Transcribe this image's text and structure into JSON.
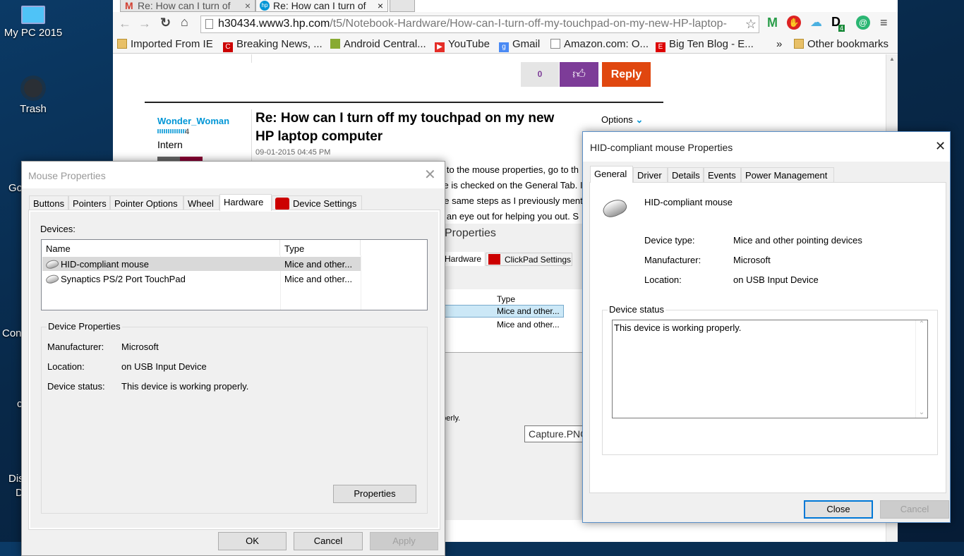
{
  "desktop": {
    "icons": [
      "My PC 2015",
      "Trash",
      "Go",
      "Con",
      "c",
      "Dis",
      "D"
    ]
  },
  "browser": {
    "tabs": [
      {
        "title": "Re: How can I turn of",
        "icon": "gmail-icon"
      },
      {
        "title": "Re: How can I turn of",
        "icon": "hp-icon"
      }
    ],
    "url_host": "h30434.www3.hp.com",
    "url_path": "/t5/Notebook-Hardware/How-can-I-turn-off-my-touchpad-on-my-new-HP-laptop-",
    "extensions": [
      "M",
      "✋",
      "☁",
      "D",
      "@"
    ],
    "ext_badge": "4",
    "bookmarks": [
      "Imported From IE",
      "Breaking News, ...",
      "Android Central...",
      "YouTube",
      "Gmail",
      "Amazon.com: O...",
      "Big Ten Blog - E..."
    ],
    "bookmarks_overflow": "»",
    "other_bookmarks": "Other bookmarks"
  },
  "post": {
    "kudos_count": "0",
    "reply_label": "Reply",
    "author": "Wonder_Woman",
    "rank_level": "4",
    "rank": "Intern",
    "title": "Re: How can I turn off my touchpad on my new HP laptop computer",
    "date": "09-01-2015 04:45 PM",
    "options_label": "Options",
    "body_lines": [
      "o to the mouse properties, go to th",
      "se is checked on the General Tab.  I",
      "he same steps as I previously ment",
      "p an eye out for helping you out.  S"
    ],
    "embedded": {
      "title": "Properties",
      "tab_hardware": "Hardware",
      "tab_clickpad": "ClickPad Settings",
      "col_type": "Type",
      "row1": "Mice and other...",
      "row2": "Mice and other...",
      "status_tail": "operly."
    },
    "tooltip": "Capture.PNG"
  },
  "mouse_props": {
    "title": "Mouse Properties",
    "tabs": [
      "Buttons",
      "Pointers",
      "Pointer Options",
      "Wheel",
      "Hardware",
      "Device Settings"
    ],
    "devices_label": "Devices:",
    "columns": [
      "Name",
      "Type"
    ],
    "devices": [
      {
        "name": "HID-compliant mouse",
        "type": "Mice and other..."
      },
      {
        "name": "Synaptics PS/2 Port TouchPad",
        "type": "Mice and other..."
      }
    ],
    "group_label": "Device Properties",
    "props": [
      {
        "label": "Manufacturer:",
        "value": "Microsoft"
      },
      {
        "label": "Location:",
        "value": "on USB Input Device"
      },
      {
        "label": "Device status:",
        "value": "This device is working properly."
      }
    ],
    "properties_button": "Properties",
    "ok": "OK",
    "cancel": "Cancel",
    "apply": "Apply"
  },
  "hid_props": {
    "title": "HID-compliant mouse Properties",
    "tabs": [
      "General",
      "Driver",
      "Details",
      "Events",
      "Power Management"
    ],
    "device_name": "HID-compliant mouse",
    "props": [
      {
        "label": "Device type:",
        "value": "Mice and other pointing devices"
      },
      {
        "label": "Manufacturer:",
        "value": "Microsoft"
      },
      {
        "label": "Location:",
        "value": "on USB Input Device"
      }
    ],
    "status_group": "Device status",
    "status_text": "This device is working properly.",
    "close": "Close",
    "cancel": "Cancel"
  },
  "colors": {
    "purple": "#7d3c98",
    "reply": "#e0470f",
    "link": "#0096d6",
    "accent": "#0078d7"
  }
}
